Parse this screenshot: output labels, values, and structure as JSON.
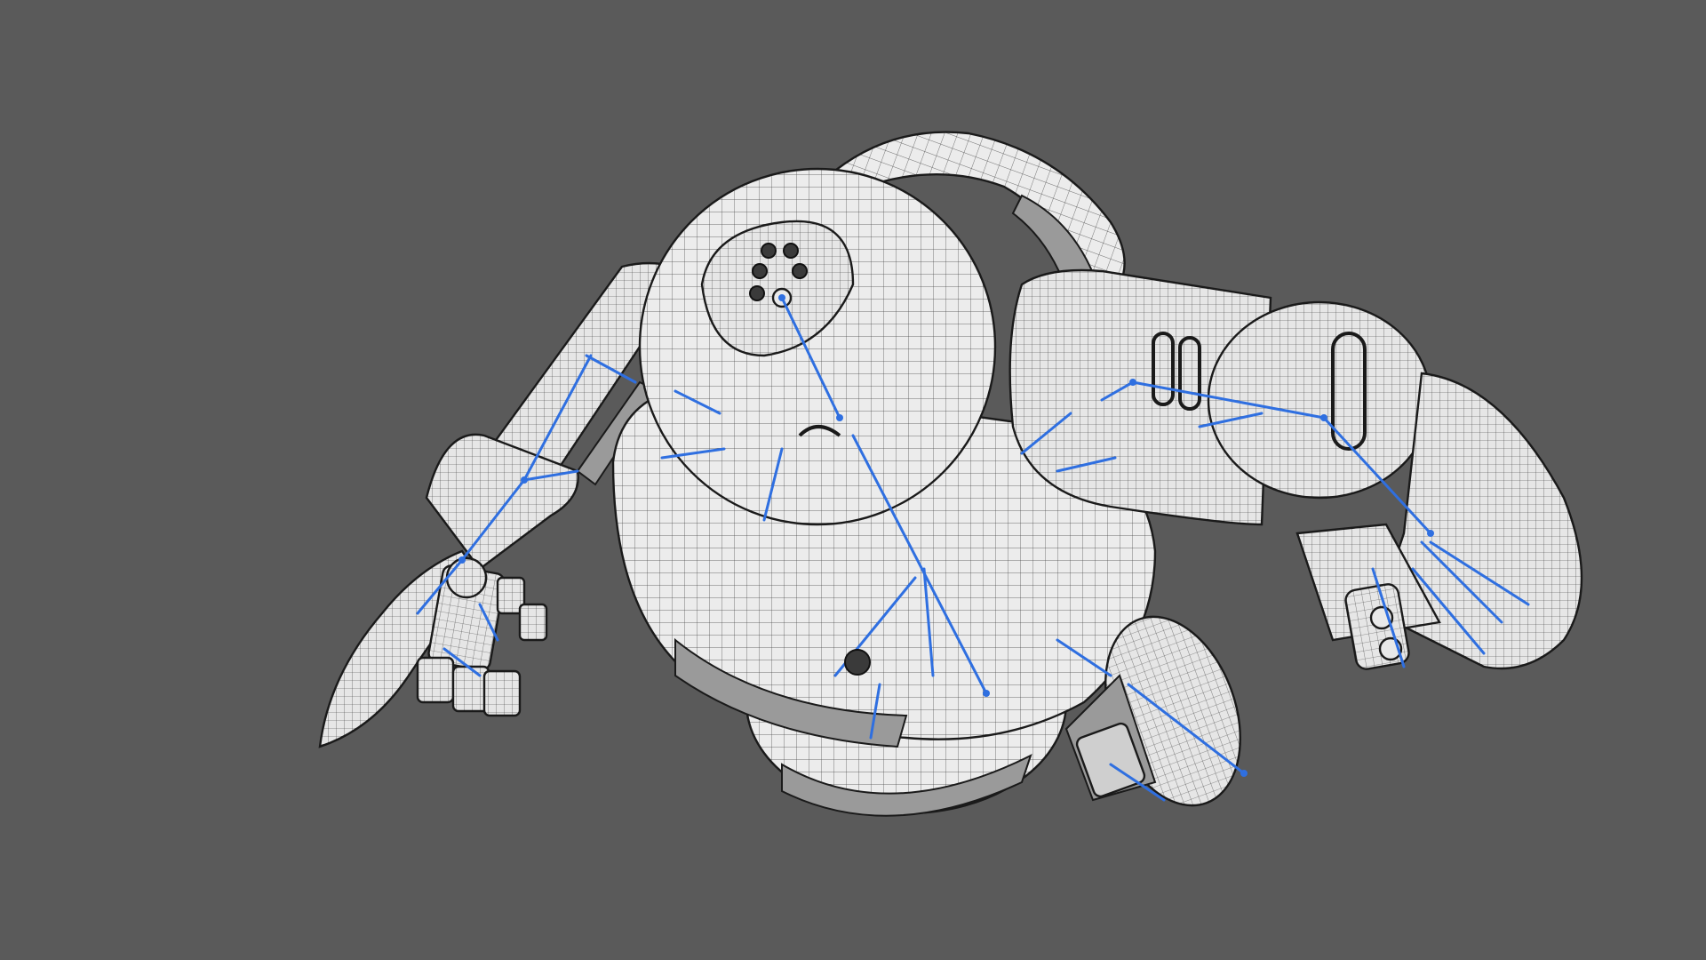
{
  "viewport": {
    "background_color": "#5a5a5a",
    "model_fill_color": "#e9e9e9",
    "wire_color": "#1a1a1a",
    "rig_bone_color": "#2f6fe0"
  }
}
